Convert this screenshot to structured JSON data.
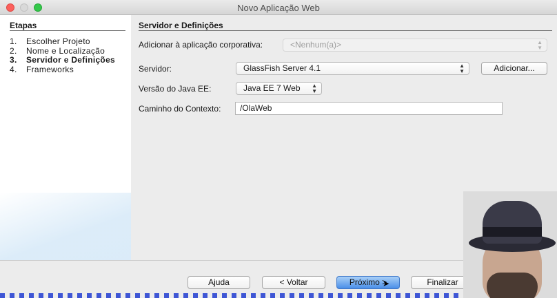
{
  "window": {
    "title": "Novo Aplicação Web"
  },
  "steps": {
    "heading": "Etapas",
    "items": [
      {
        "num": "1.",
        "label": "Escolher Projeto"
      },
      {
        "num": "2.",
        "label": "Nome e Localização"
      },
      {
        "num": "3.",
        "label": "Servidor e Definições"
      },
      {
        "num": "4.",
        "label": "Frameworks"
      }
    ],
    "active_index": 2
  },
  "form": {
    "heading": "Servidor e Definições",
    "enterprise_label": "Adicionar à aplicação corporativa:",
    "enterprise_value": "<Nenhum(a)>",
    "server_label": "Servidor:",
    "server_value": "GlassFish Server 4.1",
    "add_button": "Adicionar...",
    "javaee_label": "Versão do Java EE:",
    "javaee_value": "Java EE 7 Web",
    "context_label": "Caminho do Contexto:",
    "context_value": "/OlaWeb"
  },
  "buttons": {
    "help": "Ajuda",
    "back": "< Voltar",
    "next": "Próximo >",
    "finish": "Finalizar"
  },
  "icons": {
    "dropdown": "up-down-chevron-icon",
    "cursor": "mouse-pointer-icon"
  }
}
